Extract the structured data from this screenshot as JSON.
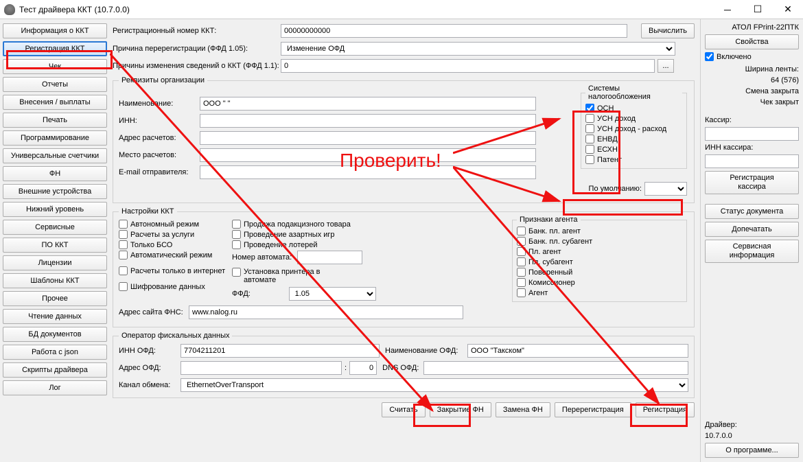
{
  "window": {
    "title": "Тест драйвера ККТ (10.7.0.0)"
  },
  "sidebar": {
    "items": [
      "Информация о ККТ",
      "Регистрация ККТ",
      "Чек",
      "Отчеты",
      "Внесения / выплаты",
      "Печать",
      "Программирование",
      "Универсальные счетчики",
      "ФН",
      "Внешние устройства",
      "Нижний уровень",
      "Сервисные",
      "ПО ККТ",
      "Лицензии",
      "Шаблоны ККТ",
      "Прочее",
      "Чтение данных",
      "БД документов",
      "Работа с json",
      "Скрипты драйвера",
      "Лог"
    ]
  },
  "main": {
    "reg_num_label": "Регистрационный номер ККТ:",
    "reg_num_value": "00000000000",
    "calc_btn": "Вычислить",
    "rereg_reason_label": "Причина перерегистрации (ФФД 1.05):",
    "rereg_reason_value": "Изменение ОФД",
    "chg_reason_label": "Причины изменения сведений о ККТ (ФФД 1.1):",
    "chg_reason_value": "0",
    "ellipsis": "..."
  },
  "org": {
    "legend": "Реквизиты организации",
    "name_label": "Наименование:",
    "name_value": "ООО \" \"",
    "inn_label": "ИНН:",
    "inn_value": "",
    "addr_label": "Адрес расчетов:",
    "addr_value": "",
    "place_label": "Место расчетов:",
    "place_value": "",
    "email_label": "E-mail отправителя:",
    "email_value": "",
    "tax_legend": "Системы налогообложения",
    "tax_items": [
      "ОСН",
      "УСН доход",
      "УСН доход - расход",
      "ЕНВД",
      "ЕСХН",
      "Патент"
    ],
    "default_label": "По умолчанию:"
  },
  "settings": {
    "legend": "Настройки ККТ",
    "col1": [
      "Автономный режим",
      "Расчеты за услуги",
      "Только БСО",
      "Автоматический режим",
      "Расчеты только в интернет",
      "Шифрование данных"
    ],
    "col2": [
      "Продажа подакцизного товара",
      "Проведение азартных игр",
      "Проведение лотерей"
    ],
    "automat_label": "Номер автомата:",
    "automat_value": "",
    "printer_label": "Установка принтера в автомате",
    "ffd_label": "ФФД:",
    "ffd_value": "1.05",
    "fns_label": "Адрес сайта ФНС:",
    "fns_value": "www.nalog.ru",
    "agent_legend": "Признаки агента",
    "agent_items": [
      "Банк. пл. агент",
      "Банк. пл. субагент",
      "Пл. агент",
      "Пл. субагент",
      "Поверенный",
      "Комиссионер",
      "Агент"
    ]
  },
  "ofd": {
    "legend": "Оператор фискальных данных",
    "inn_label": "ИНН ОФД:",
    "inn_value": "7704211201",
    "name_label": "Наименование ОФД:",
    "name_value": "ООО \"Такском\"",
    "addr_label": "Адрес ОФД:",
    "addr_value": "",
    "port_value": "0",
    "dns_label": "DNS ОФД:",
    "dns_value": "",
    "channel_label": "Канал обмена:",
    "channel_value": "EthernetOverTransport"
  },
  "buttons": {
    "read": "Считать",
    "close_fn": "Закрытие ФН",
    "replace_fn": "Замена ФН",
    "rereg": "Перерегистрация",
    "reg": "Регистрация"
  },
  "right": {
    "device": "АТОЛ FPrint-22ПТК",
    "props_btn": "Свойства",
    "enabled_label": "Включено",
    "tape_width": "Ширина ленты:",
    "tape_value": "64 (576)",
    "shift_closed": "Смена закрыта",
    "check_closed": "Чек закрыт",
    "cashier_label": "Кассир:",
    "cashier_inn_label": "ИНН кассира:",
    "cashier_reg_btn": "Регистрация\nкассира",
    "doc_status_btn": "Статус документа",
    "print_more_btn": "Допечатать",
    "service_info_btn": "Сервисная\nинформация",
    "driver_label": "Драйвер:",
    "driver_ver": "10.7.0.0",
    "about_btn": "О программе..."
  },
  "annotation": {
    "check_text": "Проверить!"
  }
}
